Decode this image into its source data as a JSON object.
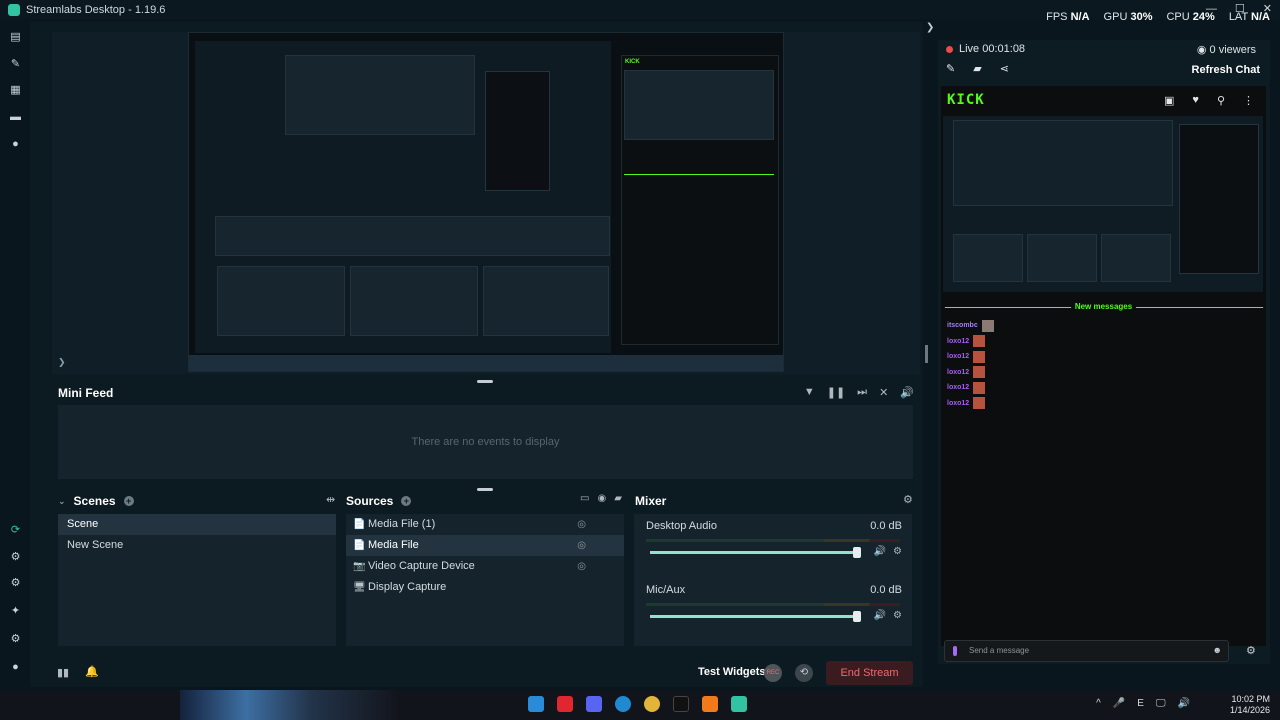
{
  "window": {
    "title": "Streamlabs Desktop - 1.19.6",
    "controls": [
      "—",
      "☐",
      "✕"
    ]
  },
  "stats": {
    "fps_label": "FPS",
    "fps": "N/A",
    "gpu_label": "GPU",
    "gpu": "30%",
    "cpu_label": "CPU",
    "cpu": "24%",
    "lat_label": "LAT",
    "lat": "N/A"
  },
  "sidebar_icons": [
    "dashboard-icon",
    "themes-icon",
    "store-icon",
    "library-icon",
    "play-icon",
    "go-live-icon",
    "crash-icon",
    "layout-icon",
    "add-icon",
    "settings-icon",
    "profile-icon"
  ],
  "minifeed": {
    "title": "Mini Feed",
    "empty": "There are no events to display"
  },
  "scenes": {
    "title": "Scenes",
    "items": [
      "Scene",
      "New Scene"
    ]
  },
  "sources": {
    "title": "Sources",
    "items": [
      {
        "label": "Media File (1)",
        "icon": "📄"
      },
      {
        "label": "Media File",
        "icon": "📄"
      },
      {
        "label": "Video Capture Device",
        "icon": "📷"
      },
      {
        "label": "Display Capture",
        "icon": "🖥"
      }
    ]
  },
  "mixer": {
    "title": "Mixer",
    "channels": [
      {
        "name": "Desktop Audio",
        "db": "0.0 dB"
      },
      {
        "name": "Mic/Aux",
        "db": "0.0 dB"
      }
    ]
  },
  "footer": {
    "test_widgets": "Test Widgets",
    "rec": "REC",
    "end_stream": "End Stream"
  },
  "chat": {
    "live": "Live 00:01:08",
    "viewers": "0 viewers",
    "refresh": "Refresh Chat",
    "logo": "KICK",
    "new_messages": "New messages",
    "messages": [
      {
        "user": "itscombc"
      },
      {
        "user": "loxo12"
      },
      {
        "user": "loxo12"
      },
      {
        "user": "loxo12"
      },
      {
        "user": "loxo12"
      },
      {
        "user": "loxo12"
      }
    ],
    "placeholder": "Send a message"
  },
  "clock": {
    "time": "10:02 PM",
    "date": "1/14/2026"
  },
  "tray": [
    "^",
    "🎤",
    "E",
    "🖵",
    "🔊"
  ],
  "taskbar_colors": [
    "#2a8bd8",
    "#e0262e",
    "#5865f2",
    "#1f8ad2",
    "#e2b53a",
    "#111111",
    "#f27a1a",
    "#31c3a2"
  ],
  "accent": {
    "kick": "#53fc18",
    "end_stream": "#f5686d",
    "live": "#ef4a4a",
    "streamlabs": "#31c3a2"
  }
}
